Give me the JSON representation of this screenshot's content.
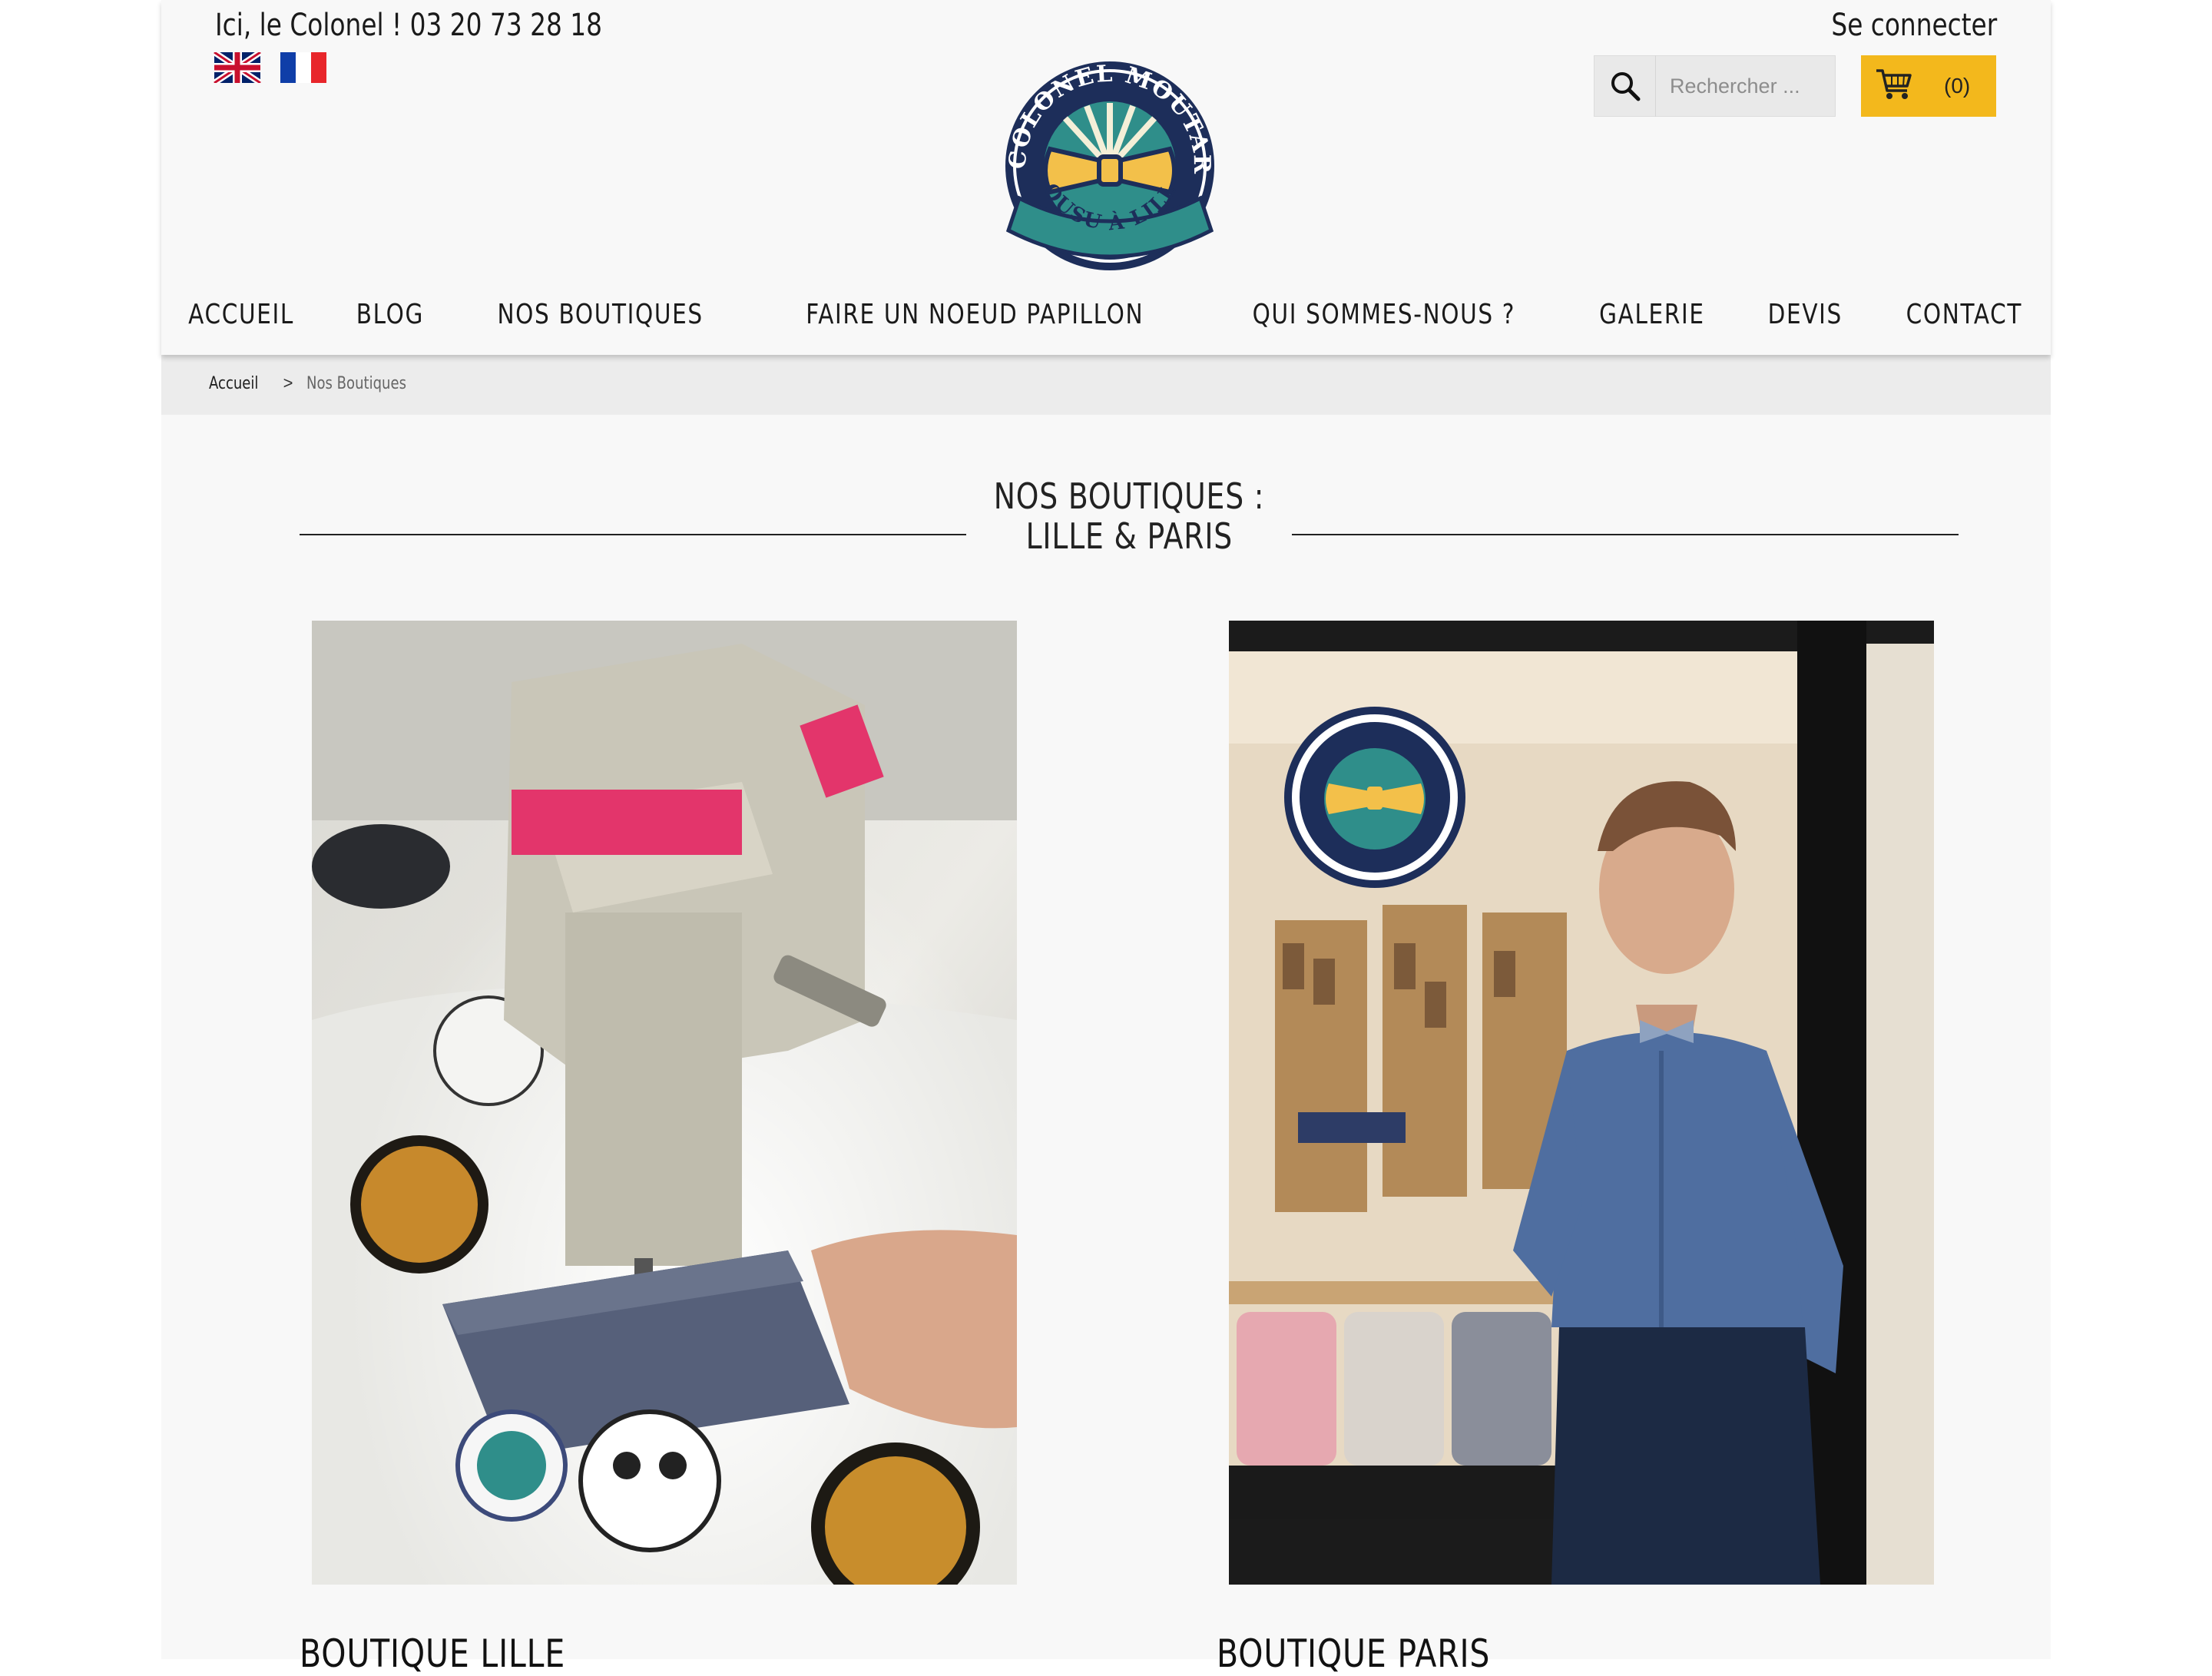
{
  "header": {
    "phone": "Ici, le Colonel ! 03 20 73 28 18",
    "login": "Se connecter",
    "flags": [
      "english-flag",
      "french-flag"
    ],
    "logo": {
      "top_text": "LE COLONEL MOUTARDE",
      "bottom_text": "COUSU À LILLE"
    },
    "search_placeholder": "Rechercher ...",
    "cart_count": "(0)",
    "accent_color": "#f3b81c"
  },
  "nav": {
    "items": [
      "ACCUEIL",
      "BLOG",
      "NOS BOUTIQUES",
      "FAIRE UN NOEUD PAPILLON",
      "QUI SOMMES-NOUS ?",
      "GALERIE",
      "DEVIS",
      "CONTACT"
    ]
  },
  "breadcrumb": {
    "home": "Accueil",
    "separator": ">",
    "current": "Nos Boutiques"
  },
  "main": {
    "title_line1": "NOS BOUTIQUES :",
    "title_line2": "LILLE & PARIS",
    "shops": [
      {
        "title": "BOUTIQUE LILLE",
        "image": "sewing-machine-photo"
      },
      {
        "title": "BOUTIQUE PARIS",
        "image": "shop-front-photo"
      }
    ]
  }
}
